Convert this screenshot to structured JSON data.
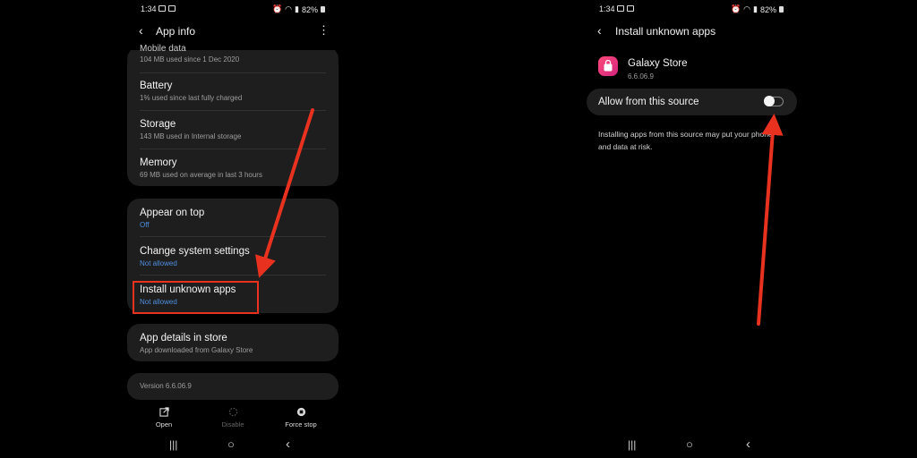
{
  "left": {
    "status": {
      "time": "1:34",
      "battery": "82%"
    },
    "header": {
      "title": "App info"
    },
    "usage_group": [
      {
        "title": "Mobile data",
        "sub": "104 MB used since 1 Dec 2020"
      },
      {
        "title": "Battery",
        "sub": "1% used since last fully charged"
      },
      {
        "title": "Storage",
        "sub": "143 MB used in Internal storage"
      },
      {
        "title": "Memory",
        "sub": "69 MB used on average in last 3 hours"
      }
    ],
    "permission_group": [
      {
        "title": "Appear on top",
        "sub": "Off"
      },
      {
        "title": "Change system settings",
        "sub": "Not allowed"
      },
      {
        "title": "Install unknown apps",
        "sub": "Not allowed"
      }
    ],
    "store": {
      "title": "App details in store",
      "sub": "App downloaded from Galaxy Store"
    },
    "version": "Version 6.6.06.9",
    "actions": {
      "open": "Open",
      "disable": "Disable",
      "force_stop": "Force stop"
    }
  },
  "right": {
    "status": {
      "time": "1:34",
      "battery": "82%"
    },
    "header": {
      "title": "Install unknown apps"
    },
    "app": {
      "name": "Galaxy Store",
      "version": "6.6.06.9"
    },
    "toggle": {
      "label": "Allow from this source",
      "state": "off"
    },
    "warning": "Installing apps from this source may put your phone and data at risk."
  },
  "colors": {
    "card": "#1e1e1e",
    "accent_blue": "#4f8fe0",
    "highlight": "#e8321f"
  }
}
